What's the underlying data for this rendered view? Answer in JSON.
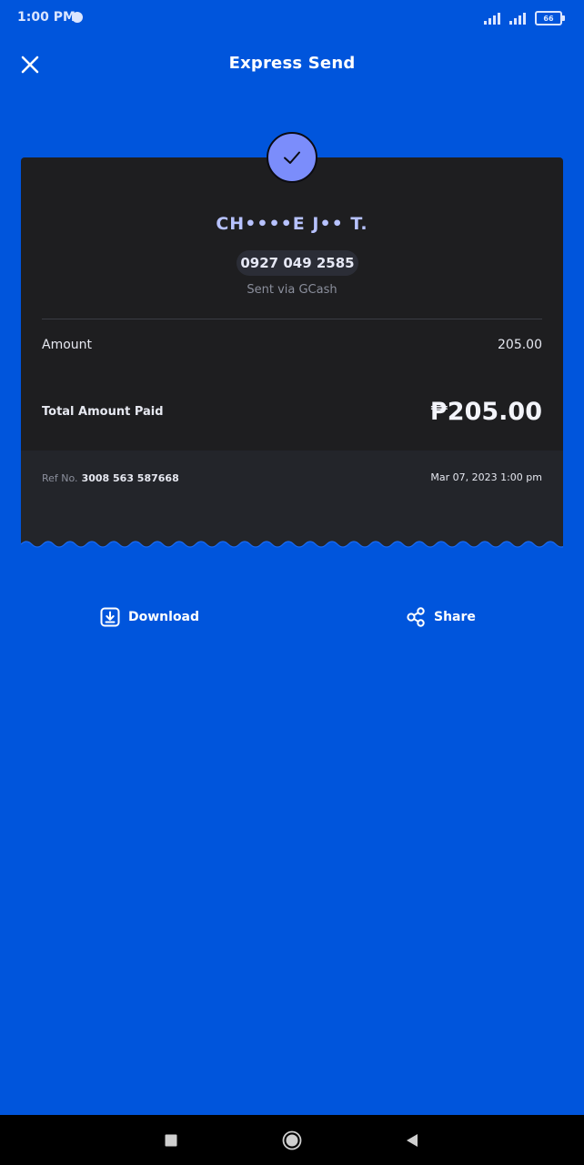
{
  "status_bar": {
    "time": "1:00 PM",
    "battery_level": "66",
    "icons": [
      "app-notification-icon",
      "signal-icon",
      "signal-icon",
      "battery-icon"
    ]
  },
  "header": {
    "title": "Express Send",
    "close_icon": "close-icon"
  },
  "receipt": {
    "status_icon": "check-icon",
    "recipient_name": "CH••••E J•• T.",
    "phone_number": "0927 049 2585",
    "sent_via": "Sent via GCash",
    "amount_label": "Amount",
    "amount_value": "205.00",
    "total_label": "Total Amount Paid",
    "total_value": "₱205.00",
    "ref_label": "Ref No.",
    "ref_number": "3008 563 587668",
    "date": "Mar 07, 2023 1:00 pm"
  },
  "actions": {
    "download_label": "Download",
    "share_label": "Share"
  },
  "nav_bar": {
    "items": [
      "recent-apps-icon",
      "home-icon",
      "back-icon"
    ]
  },
  "colors": {
    "background": "#0055DC",
    "card": "#1E1E20",
    "card_footer": "#23252A",
    "accent": "#7B8DFB",
    "recipient_text": "#B7C2FF"
  }
}
